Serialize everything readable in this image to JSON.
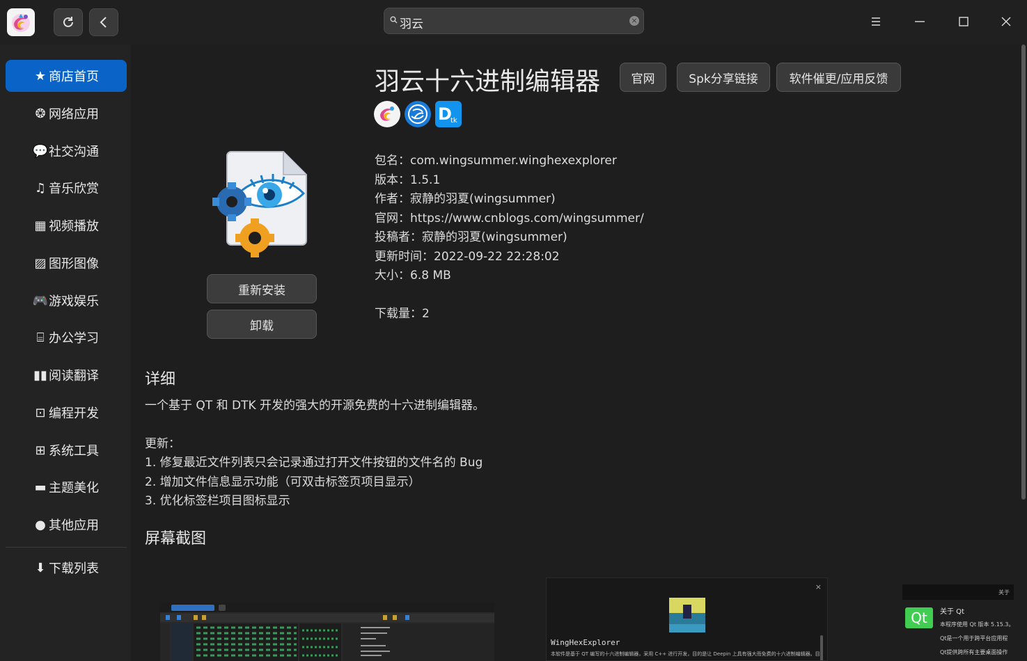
{
  "search": {
    "value": "羽云"
  },
  "sidebar": {
    "items": [
      {
        "label": "商店首页",
        "icon": "star-icon",
        "active": true
      },
      {
        "label": "网络应用",
        "icon": "network-icon"
      },
      {
        "label": "社交沟通",
        "icon": "chat-icon"
      },
      {
        "label": "音乐欣赏",
        "icon": "music-icon"
      },
      {
        "label": "视频播放",
        "icon": "film-icon"
      },
      {
        "label": "图形图像",
        "icon": "image-icon"
      },
      {
        "label": "游戏娱乐",
        "icon": "gamepad-icon"
      },
      {
        "label": "办公学习",
        "icon": "presentation-icon"
      },
      {
        "label": "阅读翻译",
        "icon": "book-icon"
      },
      {
        "label": "编程开发",
        "icon": "terminal-icon"
      },
      {
        "label": "系统工具",
        "icon": "tools-icon"
      },
      {
        "label": "主题美化",
        "icon": "monitor-icon"
      },
      {
        "label": "其他应用",
        "icon": "more-icon"
      }
    ],
    "downloads": {
      "label": "下载列表",
      "icon": "download-icon"
    }
  },
  "app": {
    "title": "羽云十六进制编辑器",
    "buttons": {
      "website": "官网",
      "share": "Spk分享链接",
      "feedback": "软件催更/应用反馈"
    },
    "info": {
      "package_label": "包名：",
      "package": "com.wingsummer.winghexexplorer",
      "version_label": "版本：",
      "version": "1.5.1",
      "author_label": "作者：",
      "author": "寂静的羽夏(wingsummer)",
      "website_label": "官网：",
      "website": "https://www.cnblogs.com/wingsummer/",
      "contributor_label": "投稿者：",
      "contributor": "寂静的羽夏(wingsummer)",
      "updated_label": "更新时间：",
      "updated": "2022-09-22 22:28:02",
      "size_label": "大小：",
      "size": "6.8 MB",
      "downloads_label": "下载量：",
      "downloads": "2"
    },
    "actions": {
      "reinstall": "重新安装",
      "uninstall": "卸载"
    }
  },
  "details": {
    "title": "详细",
    "description": "一个基于 QT 和 DTK 开发的强大的开源免费的十六进制编辑器。",
    "update_heading": "更新：",
    "updates": [
      "1. 修复最近文件列表只会记录通过打开文件按钮的文件名的 Bug",
      "2. 增加文件信息显示功能（可双击标签页项目显示）",
      "3. 优化标签栏项目图标显示"
    ]
  },
  "screenshots": {
    "title": "屏幕截图",
    "shot2_title": "WingHexExplorer",
    "shot2_text": "本软件是基于 QT 编写的十六进制编辑器，采用 C++ 进行开发，目的是让 Deepin 上具有强大而免费的十六进制编辑器。目前只",
    "shot3_header": "关于",
    "shot3_title": "关于 Qt",
    "shot3_line1": "本程序使用 Qt 版本 5.15.3。",
    "shot3_line2": "Qt是一个用于跨平台应用程",
    "shot3_line3": "Qt提供跨所有主要桌面操作",
    "shot3_logo": "Qt"
  },
  "colors": {
    "accent": "#0a64c8",
    "background": "#1e1e1e"
  }
}
